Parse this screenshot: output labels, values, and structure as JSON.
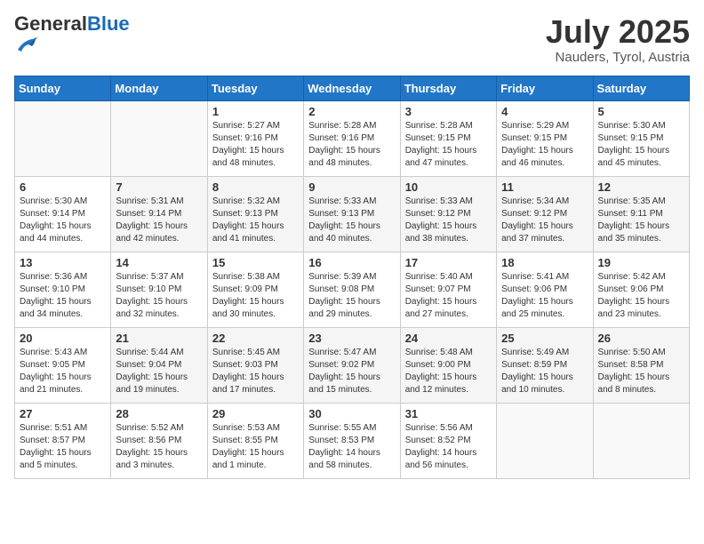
{
  "header": {
    "logo_general": "General",
    "logo_blue": "Blue",
    "month_title": "July 2025",
    "location": "Nauders, Tyrol, Austria"
  },
  "days_of_week": [
    "Sunday",
    "Monday",
    "Tuesday",
    "Wednesday",
    "Thursday",
    "Friday",
    "Saturday"
  ],
  "weeks": [
    [
      {
        "day": null,
        "detail": ""
      },
      {
        "day": null,
        "detail": ""
      },
      {
        "day": "1",
        "detail": "Sunrise: 5:27 AM\nSunset: 9:16 PM\nDaylight: 15 hours and 48 minutes."
      },
      {
        "day": "2",
        "detail": "Sunrise: 5:28 AM\nSunset: 9:16 PM\nDaylight: 15 hours and 48 minutes."
      },
      {
        "day": "3",
        "detail": "Sunrise: 5:28 AM\nSunset: 9:15 PM\nDaylight: 15 hours and 47 minutes."
      },
      {
        "day": "4",
        "detail": "Sunrise: 5:29 AM\nSunset: 9:15 PM\nDaylight: 15 hours and 46 minutes."
      },
      {
        "day": "5",
        "detail": "Sunrise: 5:30 AM\nSunset: 9:15 PM\nDaylight: 15 hours and 45 minutes."
      }
    ],
    [
      {
        "day": "6",
        "detail": "Sunrise: 5:30 AM\nSunset: 9:14 PM\nDaylight: 15 hours and 44 minutes."
      },
      {
        "day": "7",
        "detail": "Sunrise: 5:31 AM\nSunset: 9:14 PM\nDaylight: 15 hours and 42 minutes."
      },
      {
        "day": "8",
        "detail": "Sunrise: 5:32 AM\nSunset: 9:13 PM\nDaylight: 15 hours and 41 minutes."
      },
      {
        "day": "9",
        "detail": "Sunrise: 5:33 AM\nSunset: 9:13 PM\nDaylight: 15 hours and 40 minutes."
      },
      {
        "day": "10",
        "detail": "Sunrise: 5:33 AM\nSunset: 9:12 PM\nDaylight: 15 hours and 38 minutes."
      },
      {
        "day": "11",
        "detail": "Sunrise: 5:34 AM\nSunset: 9:12 PM\nDaylight: 15 hours and 37 minutes."
      },
      {
        "day": "12",
        "detail": "Sunrise: 5:35 AM\nSunset: 9:11 PM\nDaylight: 15 hours and 35 minutes."
      }
    ],
    [
      {
        "day": "13",
        "detail": "Sunrise: 5:36 AM\nSunset: 9:10 PM\nDaylight: 15 hours and 34 minutes."
      },
      {
        "day": "14",
        "detail": "Sunrise: 5:37 AM\nSunset: 9:10 PM\nDaylight: 15 hours and 32 minutes."
      },
      {
        "day": "15",
        "detail": "Sunrise: 5:38 AM\nSunset: 9:09 PM\nDaylight: 15 hours and 30 minutes."
      },
      {
        "day": "16",
        "detail": "Sunrise: 5:39 AM\nSunset: 9:08 PM\nDaylight: 15 hours and 29 minutes."
      },
      {
        "day": "17",
        "detail": "Sunrise: 5:40 AM\nSunset: 9:07 PM\nDaylight: 15 hours and 27 minutes."
      },
      {
        "day": "18",
        "detail": "Sunrise: 5:41 AM\nSunset: 9:06 PM\nDaylight: 15 hours and 25 minutes."
      },
      {
        "day": "19",
        "detail": "Sunrise: 5:42 AM\nSunset: 9:06 PM\nDaylight: 15 hours and 23 minutes."
      }
    ],
    [
      {
        "day": "20",
        "detail": "Sunrise: 5:43 AM\nSunset: 9:05 PM\nDaylight: 15 hours and 21 minutes."
      },
      {
        "day": "21",
        "detail": "Sunrise: 5:44 AM\nSunset: 9:04 PM\nDaylight: 15 hours and 19 minutes."
      },
      {
        "day": "22",
        "detail": "Sunrise: 5:45 AM\nSunset: 9:03 PM\nDaylight: 15 hours and 17 minutes."
      },
      {
        "day": "23",
        "detail": "Sunrise: 5:47 AM\nSunset: 9:02 PM\nDaylight: 15 hours and 15 minutes."
      },
      {
        "day": "24",
        "detail": "Sunrise: 5:48 AM\nSunset: 9:00 PM\nDaylight: 15 hours and 12 minutes."
      },
      {
        "day": "25",
        "detail": "Sunrise: 5:49 AM\nSunset: 8:59 PM\nDaylight: 15 hours and 10 minutes."
      },
      {
        "day": "26",
        "detail": "Sunrise: 5:50 AM\nSunset: 8:58 PM\nDaylight: 15 hours and 8 minutes."
      }
    ],
    [
      {
        "day": "27",
        "detail": "Sunrise: 5:51 AM\nSunset: 8:57 PM\nDaylight: 15 hours and 5 minutes."
      },
      {
        "day": "28",
        "detail": "Sunrise: 5:52 AM\nSunset: 8:56 PM\nDaylight: 15 hours and 3 minutes."
      },
      {
        "day": "29",
        "detail": "Sunrise: 5:53 AM\nSunset: 8:55 PM\nDaylight: 15 hours and 1 minute."
      },
      {
        "day": "30",
        "detail": "Sunrise: 5:55 AM\nSunset: 8:53 PM\nDaylight: 14 hours and 58 minutes."
      },
      {
        "day": "31",
        "detail": "Sunrise: 5:56 AM\nSunset: 8:52 PM\nDaylight: 14 hours and 56 minutes."
      },
      {
        "day": null,
        "detail": ""
      },
      {
        "day": null,
        "detail": ""
      }
    ]
  ]
}
